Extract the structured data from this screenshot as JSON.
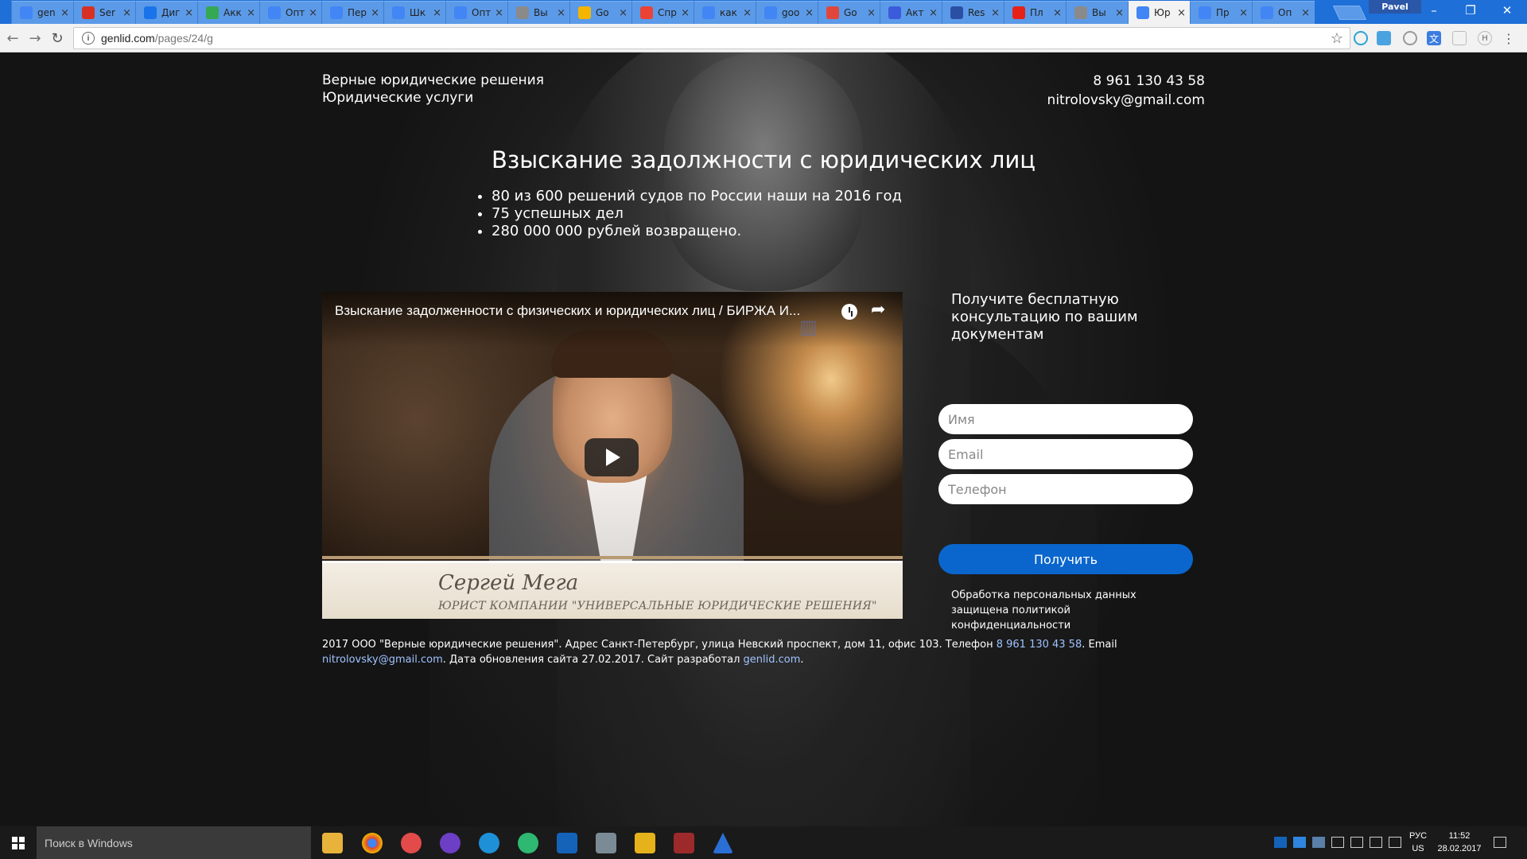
{
  "browser": {
    "tabs": [
      {
        "label": "gen",
        "icon": "g-favicon-icon",
        "color": "#4285f4"
      },
      {
        "label": "Ser",
        "icon": "gmail-icon",
        "color": "#d93025"
      },
      {
        "label": "Диг",
        "icon": "doc-icon",
        "color": "#1a73e8"
      },
      {
        "label": "Акк",
        "icon": "adwords-icon",
        "color": "#34a853"
      },
      {
        "label": "Опт",
        "icon": "g-favicon-icon",
        "color": "#4285f4"
      },
      {
        "label": "Пер",
        "icon": "g-favicon-icon",
        "color": "#4285f4"
      },
      {
        "label": "Шк",
        "icon": "g-favicon-icon",
        "color": "#4285f4"
      },
      {
        "label": "Опт",
        "icon": "g-favicon-icon",
        "color": "#4285f4"
      },
      {
        "label": "Вы",
        "icon": "gray-page-icon",
        "color": "#8a8a8a"
      },
      {
        "label": "Go",
        "icon": "yellow-page-icon",
        "color": "#f4b400"
      },
      {
        "label": "Спр",
        "icon": "maps-pin-icon",
        "color": "#ea4335"
      },
      {
        "label": "как",
        "icon": "google-icon",
        "color": "#4285f4"
      },
      {
        "label": "goo",
        "icon": "google-icon",
        "color": "#4285f4"
      },
      {
        "label": "Go",
        "icon": "red-circle-icon",
        "color": "#e0473a"
      },
      {
        "label": "Акт",
        "icon": "blue-sphere-icon",
        "color": "#3b5bdb"
      },
      {
        "label": "Res",
        "icon": "b-icon",
        "color": "#2b50a3"
      },
      {
        "label": "Пл",
        "icon": "youtube-icon",
        "color": "#e62117"
      },
      {
        "label": "Вы",
        "icon": "gray-page-icon",
        "color": "#8a8a8a"
      },
      {
        "label": "Юр",
        "icon": "g-favicon-icon",
        "color": "#4285f4",
        "active": true
      },
      {
        "label": "Пр",
        "icon": "g-favicon-icon",
        "color": "#4285f4"
      },
      {
        "label": "Оп",
        "icon": "g-favicon-icon",
        "color": "#4285f4"
      }
    ],
    "tab_close_glyph": "×",
    "profile_name": "Pavel",
    "url_host": "genlid.com",
    "url_path": "/pages/24/g"
  },
  "page": {
    "brand_line1": "Верные юридические решения",
    "brand_line2": "Юридические услуги",
    "phone": "8 961 130 43 58",
    "email": "nitrolovsky@gmail.com",
    "hero_title": "Взыскание задолжности с юридических лиц",
    "bullets": [
      "80 из 600 решений судов по России наши на 2016 год",
      "75 успешных дел",
      "280 000 000 рублей возвращено."
    ],
    "video": {
      "title": "Взыскание задолженности с физических и юридических лиц / БИРЖА И...",
      "speaker_name": "Сергей Мега",
      "speaker_role": "ЮРИСТ КОМПАНИИ \"УНИВЕРСАЛЬНЫЕ ЮРИДИЧЕСКИЕ РЕШЕНИЯ\""
    },
    "form": {
      "title": "Получите бесплатную консультацию по вашим документам",
      "name_placeholder": "Имя",
      "email_placeholder": "Email",
      "phone_placeholder": "Телефон",
      "submit_label": "Получить",
      "privacy": "Обработка персональных данных защищена политикой конфиденциальности"
    },
    "footer": {
      "text1": "2017 ООО \"Верные юридические решения\". Адрес Санкт-Петербург, улица Невский проспект, дом 11, офис 103. Телефон ",
      "phone_link": "8 961 130 43 58",
      "text2": ". Email ",
      "email_link": "nitrolovsky@gmail.com",
      "text3": ". Дата обновления сайта 27.02.2017. Сайт разработал ",
      "dev_link": "genlid.com",
      "text4": "."
    }
  },
  "taskbar": {
    "search_placeholder": "Поиск в Windows",
    "lang": "РУС",
    "layout": "US",
    "time": "11:52",
    "date": "28.02.2017"
  }
}
